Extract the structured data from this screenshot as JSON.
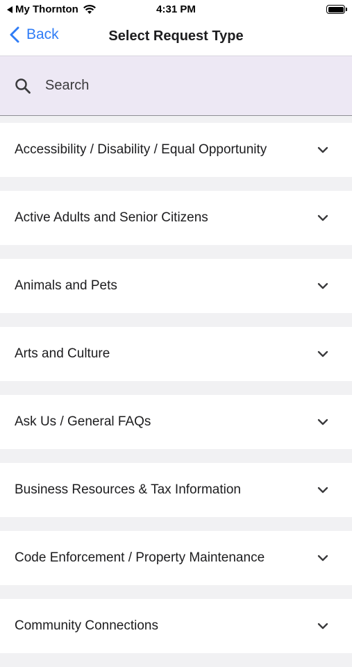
{
  "status_bar": {
    "back_app": "My Thornton",
    "time": "4:31 PM"
  },
  "nav": {
    "back_label": "Back",
    "title": "Select Request Type"
  },
  "search": {
    "placeholder": "Search"
  },
  "request_types": [
    {
      "label": "Accessibility / Disability / Equal Opportunity"
    },
    {
      "label": "Active Adults and Senior Citizens"
    },
    {
      "label": "Animals and Pets"
    },
    {
      "label": "Arts and Culture"
    },
    {
      "label": "Ask Us / General FAQs"
    },
    {
      "label": "Business Resources & Tax Information"
    },
    {
      "label": "Code Enforcement / Property Maintenance"
    },
    {
      "label": "Community Connections"
    }
  ],
  "colors": {
    "accent": "#2f7cf6",
    "search_bg": "#ede8f4",
    "list_bg": "#f1f1f3"
  }
}
